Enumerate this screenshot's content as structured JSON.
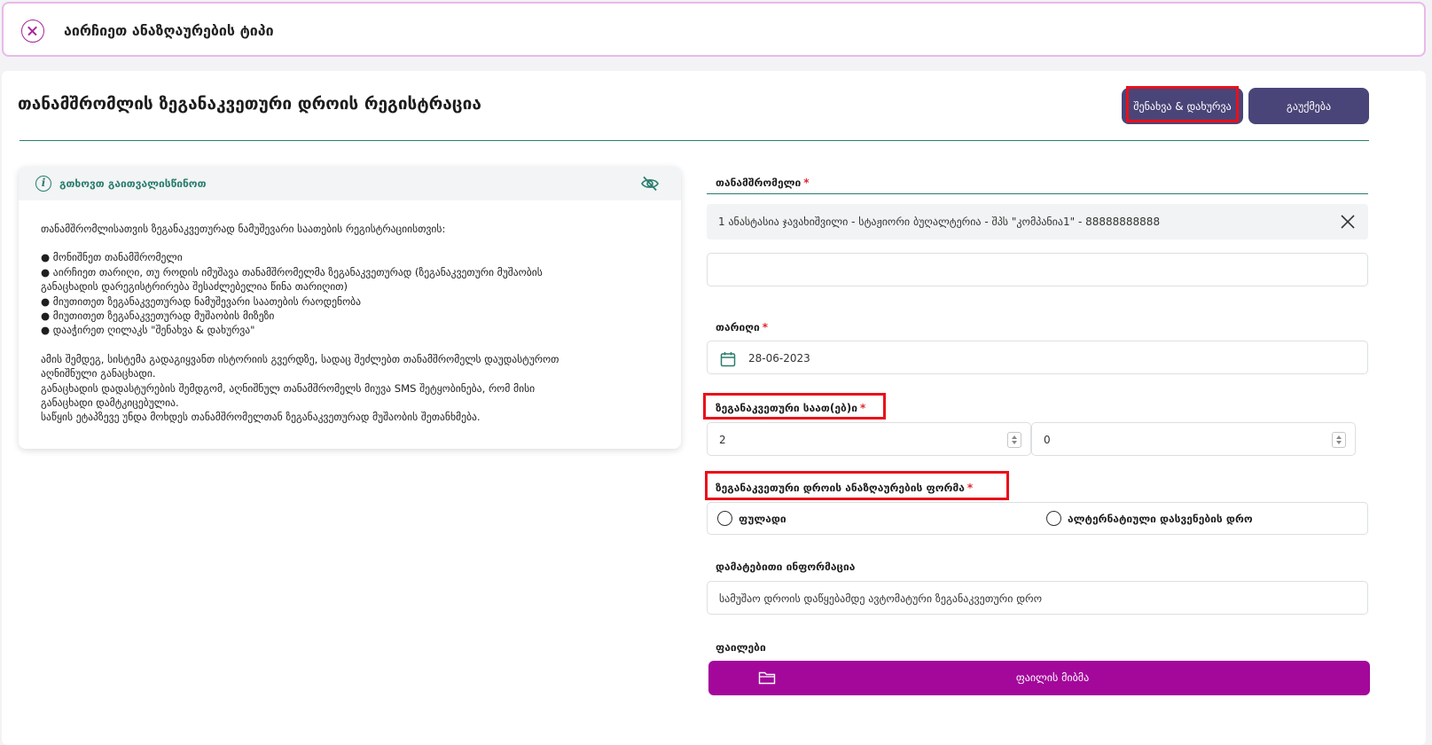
{
  "header": {
    "title": "აირჩიეთ ანაზღაურების ტიპი"
  },
  "page": {
    "title": "თანამშრომლის ზეგანაკვეთური დროის რეგისტრაცია"
  },
  "actions": {
    "save_label": "შენახვა & დახურვა",
    "cancel_label": "გაუქმება"
  },
  "info": {
    "title": "გთხოვთ გაითვალისწინოთ",
    "intro": "თანამშრომლისათვის ზეგანაკვეთურად ნამუშევარი საათების რეგისტრაციისთვის:",
    "bullets": [
      "● მონიშნეთ თანამშრომელი",
      "● აირჩიეთ თარიღი, თუ როდის იმუშავა თანამშრომელმა ზეგანაკვეთურად (ზეგანაკვეთური მუშაობის",
      "განაცხადის დარეგისტრირება შესაძლებელია წინა თარიღით)",
      "● მიუთითეთ ზეგანაკვეთურად ნამუშევარი საათების რაოდენობა",
      "● მიუთითეთ ზეგანაკვეთურად მუშაობის მიზეზი",
      "● დააჭირეთ ღილაკს \"შენახვა & დახურვა\""
    ],
    "outro": [
      "ამის შემდეგ, სისტემა გადაგიყვანთ ისტორიის გვერდზე, სადაც შეძლებთ თანამშრომელს დაუდასტუროთ",
      "აღნიშნული განაცხადი.",
      "განაცხადის დადასტურების შემდგომ, აღნიშნულ თანამშრომელს მიუვა SMS შეტყობინება, რომ მისი",
      "განაცხადი დამტკიცებულია.",
      "საწყის ეტაპზევე უნდა მოხდეს თანამშრომელთან ზეგანაკვეთურად მუშაობის შეთანხმება."
    ]
  },
  "form": {
    "employee": {
      "label": "თანამშრომელი",
      "required": "*",
      "value": "1   ანასტასია ჯავახიშვილი - სტაჟიორი ბუღალტერია - შპს \"კომპანია1\" - 88888888888"
    },
    "date": {
      "label": "თარიღი",
      "required": "*",
      "value": "28-06-2023"
    },
    "hours": {
      "label": "ზეგანაკვეთური საათ(ებ)ი",
      "required": "*",
      "hours_value": "2",
      "minutes_value": "0"
    },
    "compensation": {
      "label": "ზეგანაკვეთური დროის ანაზღაურების ფორმა",
      "required": "*",
      "options": [
        "ფულადი",
        "ალტერნატიული დასვენების დრო"
      ]
    },
    "additional": {
      "label": "დამატებითი ინფორმაცია",
      "value": "სამუშაო დროის დაწყებამდე ავტომატური ზეგანაკვეთური დრო"
    },
    "files": {
      "label": "ფაილები",
      "button_label": "ფაილის მიბმა"
    }
  },
  "colors": {
    "accent": "#4a4578",
    "teal": "#2b7d6e",
    "magenta": "#a3089b",
    "highlight": "#e8101a"
  }
}
